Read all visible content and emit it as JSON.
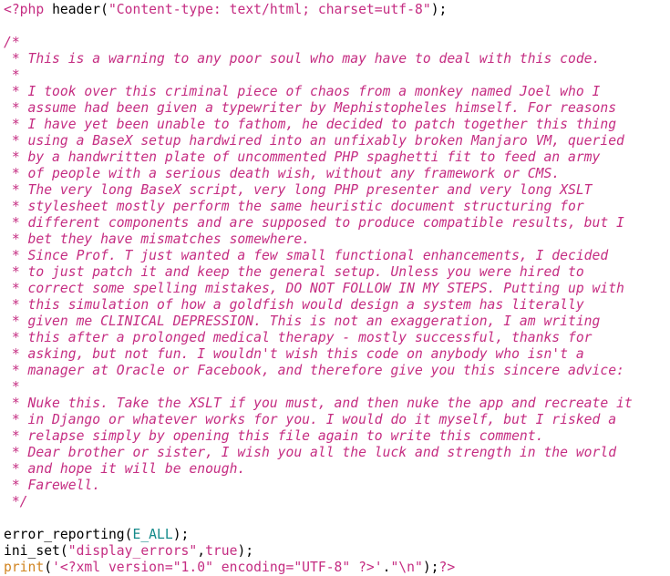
{
  "code": {
    "open_tag": "<?php",
    "header_fn": "header",
    "header_arg": "\"Content-type: text/html; charset=utf-8\"",
    "header_close": ");",
    "comment_lines": [
      "/*",
      " * This is a warning to any poor soul who may have to deal with this code.",
      " *",
      " * I took over this criminal piece of chaos from a monkey named Joel who I",
      " * assume had been given a typewriter by Mephistopheles himself. For reasons",
      " * I have yet been unable to fathom, he decided to patch together this thing",
      " * using a BaseX setup hardwired into an unfixably broken Manjaro VM, queried",
      " * by a handwritten plate of uncommented PHP spaghetti fit to feed an army",
      " * of people with a serious death wish, without any framework or CMS.",
      " * The very long BaseX script, very long PHP presenter and very long XSLT",
      " * stylesheet mostly perform the same heuristic document structuring for",
      " * different components and are supposed to produce compatible results, but I",
      " * bet they have mismatches somewhere.",
      " * Since Prof. T just wanted a few small functional enhancements, I decided",
      " * to just patch it and keep the general setup. Unless you were hired to",
      " * correct some spelling mistakes, DO NOT FOLLOW IN MY STEPS. Putting up with",
      " * this simulation of how a goldfish would design a system has literally",
      " * given me CLINICAL DEPRESSION. This is not an exaggeration, I am writing",
      " * this after a prolonged medical therapy - mostly successful, thanks for",
      " * asking, but not fun. I wouldn't wish this code on anybody who isn't a",
      " * manager at Oracle or Facebook, and therefore give you this sincere advice:",
      " *",
      " * Nuke this. Take the XSLT if you must, and then nuke the app and recreate it",
      " * in Django or whatever works for you. I would do it myself, but I risked a",
      " * relapse simply by opening this file again to write this comment.",
      " * Dear brother or sister, I wish you all the luck and strength in the world",
      " * and hope it will be enough.",
      " * Farewell.",
      " */"
    ],
    "err_fn": "error_reporting",
    "err_const": "E_ALL",
    "err_close": ");",
    "ini_fn": "ini_set",
    "ini_arg1": "\"display_errors\"",
    "ini_bool": "true",
    "ini_close": ");",
    "print_kw": "print",
    "print_arg1": "'<?xml version=\"1.0\" encoding=\"UTF-8\" ?>'",
    "print_dot": ".",
    "print_arg2": "\"\\n\"",
    "print_close": ");",
    "close_tag": "?>"
  }
}
